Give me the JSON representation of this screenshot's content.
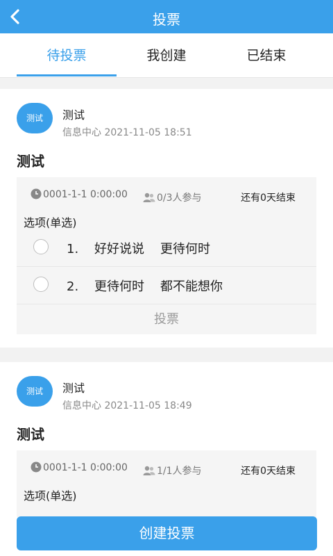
{
  "header": {
    "title": "投票"
  },
  "tabs": [
    {
      "label": "待投票"
    },
    {
      "label": "我创建"
    },
    {
      "label": "已结束"
    }
  ],
  "polls": [
    {
      "avatar_text": "测试",
      "author": "测试",
      "meta": "信息中心 2021-11-05 18:51",
      "title": "测试",
      "time": "0001-1-1 0:00:00",
      "participants": "0/3人参与",
      "remaining": "还有0天结束",
      "type": "选项(单选)",
      "options": [
        "1.    好好说说    更待何时",
        "2.    更待何时    都不能想你"
      ],
      "vote_label": "投票"
    },
    {
      "avatar_text": "测试",
      "author": "测试",
      "meta": "信息中心 2021-11-05 18:49",
      "title": "测试",
      "time": "0001-1-1 0:00:00",
      "participants": "1/1人参与",
      "remaining": "还有0天结束",
      "type": "选项(单选)"
    }
  ],
  "footer": {
    "create_label": "创建投票"
  },
  "colors": {
    "accent": "#3aa0ea",
    "background": "#f2f2f2"
  },
  "icons": [
    "back-arrow-icon",
    "clock-icon",
    "users-icon",
    "radio-unchecked-icon"
  ]
}
